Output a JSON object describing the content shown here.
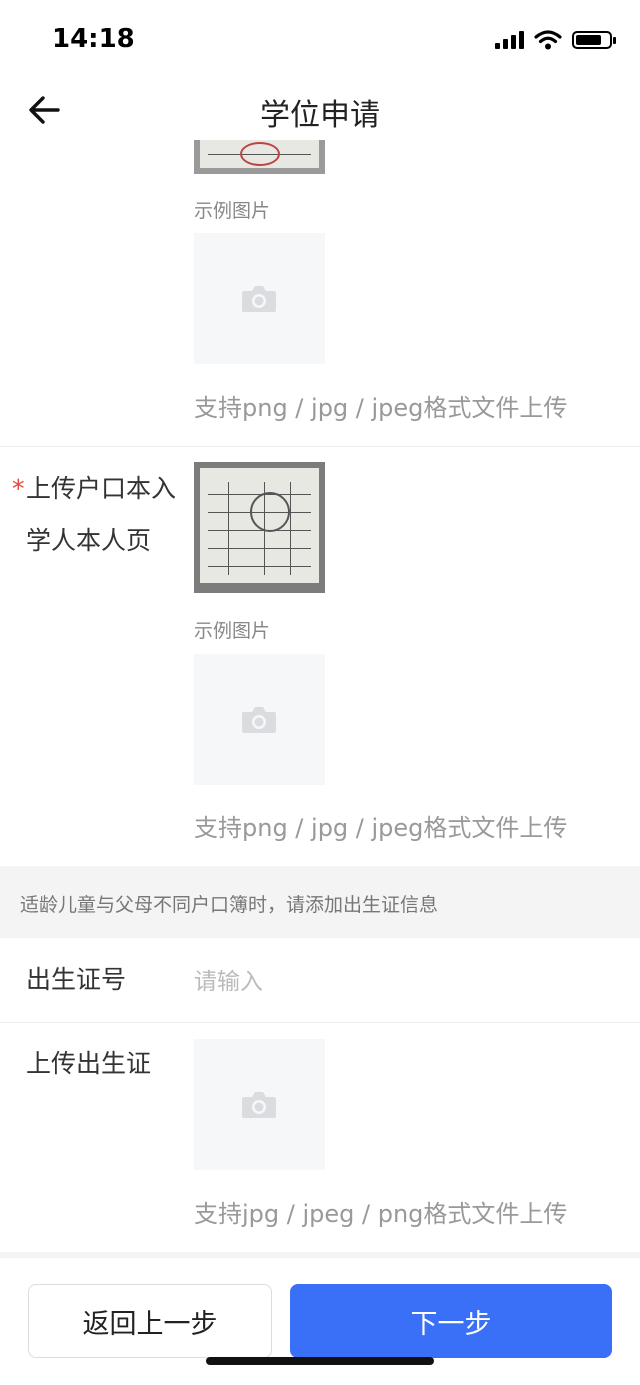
{
  "status_bar": {
    "time": "14:18"
  },
  "nav": {
    "title": "学位申请",
    "back_icon": "arrow-left-icon"
  },
  "section_top": {
    "example_label": "示例图片",
    "hint": "支持png / jpg / jpeg格式文件上传"
  },
  "hukou_field": {
    "required_mark": "*",
    "label": "上传户口本入学人本人页",
    "example_label": "示例图片",
    "hint": "支持png / jpg / jpeg格式文件上传"
  },
  "notice": {
    "text": "适龄儿童与父母不同户口簿时，请添加出生证信息"
  },
  "birth_cert_number": {
    "label": "出生证号",
    "placeholder": "请输入"
  },
  "birth_cert_upload": {
    "label": "上传出生证",
    "hint": "支持jpg / jpeg / png格式文件上传"
  },
  "footer": {
    "prev_label": "返回上一步",
    "next_label": "下一步"
  },
  "colors": {
    "primary": "#3a6ff7",
    "required": "#e6453a",
    "hint": "#999999"
  }
}
